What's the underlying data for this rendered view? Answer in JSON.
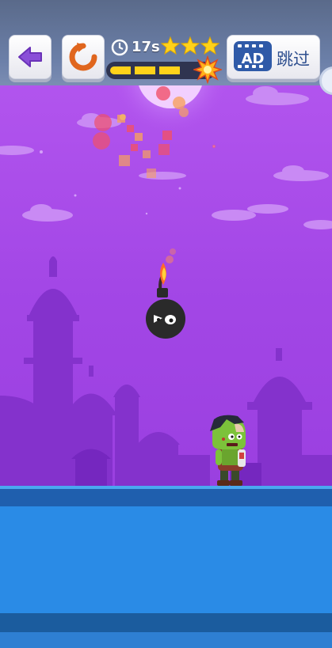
{
  "hud": {
    "back_button": "back-arrow-icon",
    "restart_button": "restart-icon",
    "timer": {
      "icon": "clock-icon",
      "value": "17s"
    },
    "stars": {
      "earned": 3,
      "total": 3,
      "color": "#ffd21a"
    },
    "progress": {
      "fraction": 0.85,
      "end_icon": "explosion-icon"
    },
    "skip_button": {
      "badge": "AD",
      "label": "跳过"
    }
  },
  "scene": {
    "background": "night-city-silhouette",
    "moon": "moon",
    "colors": {
      "sky": "#a345e6",
      "silhouette": "#7d2fc4",
      "ground": "#2a8be6"
    }
  },
  "characters": {
    "bomb": {
      "type": "bomb-enemy",
      "fuse": "lit"
    },
    "zombie": {
      "type": "zombie-player"
    }
  }
}
